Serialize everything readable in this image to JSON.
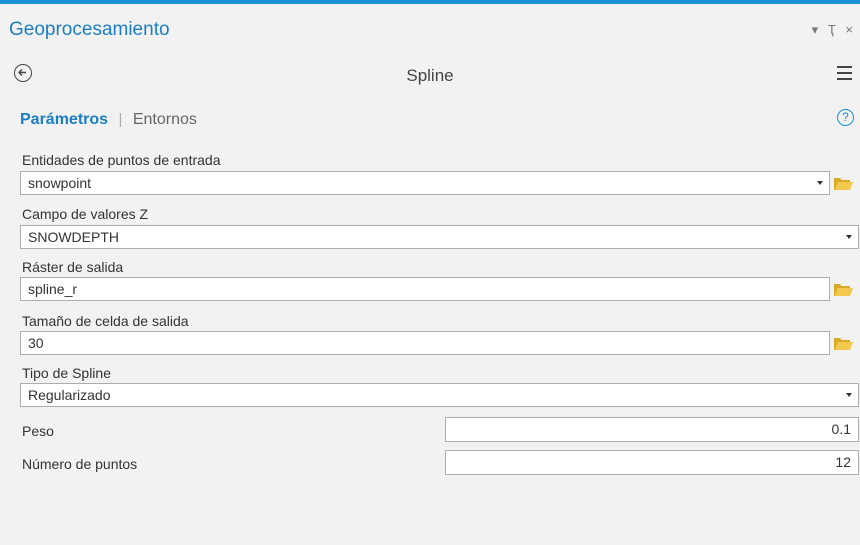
{
  "panel": {
    "title": "Geoprocesamiento",
    "controls": {
      "dropdown": "▾",
      "pin": "Ҭ",
      "close": "×"
    }
  },
  "tool": {
    "name": "Spline"
  },
  "tabs": {
    "active": "Parámetros",
    "separator": "|",
    "inactive": "Entornos",
    "help": "?"
  },
  "params": {
    "input_points": {
      "label": "Entidades de puntos de entrada",
      "value": "snowpoint"
    },
    "z_field": {
      "label": "Campo de valores Z",
      "value": "SNOWDEPTH"
    },
    "output_raster": {
      "label": "Ráster de salida",
      "value": "spline_r"
    },
    "cell_size": {
      "label": "Tamaño de celda de salida",
      "value": "30"
    },
    "spline_type": {
      "label": "Tipo de Spline",
      "value": "Regularizado"
    },
    "weight": {
      "label": "Peso",
      "value": "0.1"
    },
    "num_points": {
      "label": "Número de puntos",
      "value": "12"
    }
  },
  "colors": {
    "accent": "#1b8fd8",
    "folder": "#f2c94c"
  }
}
